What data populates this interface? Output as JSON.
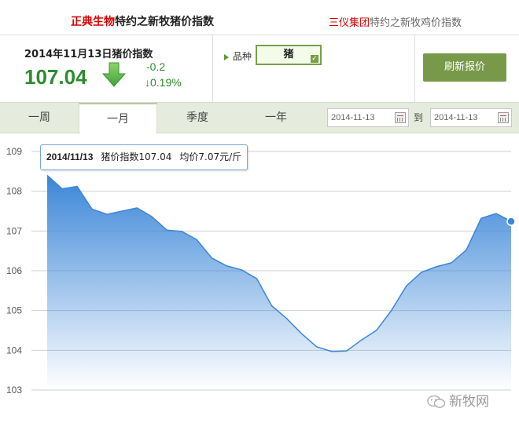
{
  "sponsors": {
    "left_brand": "正典生物",
    "left_text": "特约之新牧猪价指数",
    "right_brand": "三仪集团",
    "right_text": "特约之新牧鸡价指数"
  },
  "summary": {
    "title": "2014年11月13日猪价指数",
    "value": "107.04",
    "trend_icon": "arrow-down-icon",
    "change_abs": "-0.2",
    "change_pct": "↓0.19%"
  },
  "species": {
    "label": "品种",
    "selected": "猪"
  },
  "refresh_label": "刷新报价",
  "tabs": [
    {
      "label": "一周",
      "active": false
    },
    {
      "label": "一月",
      "active": true
    },
    {
      "label": "季度",
      "active": false
    },
    {
      "label": "一年",
      "active": false
    }
  ],
  "date_range": {
    "start": "2014-11-13",
    "separator": "到",
    "end": "2014-11-13"
  },
  "tooltip": {
    "date": "2014/11/13",
    "index_text": "猪价指数107.04",
    "avg_text": "均价7.07元/斤"
  },
  "watermark": "新牧网",
  "colors": {
    "accent_green": "#2e8b2e",
    "button_green": "#79994a",
    "brand_red": "#d60000",
    "series_blue": "#3b86d8"
  },
  "chart_data": {
    "type": "area",
    "yticks": [
      103,
      104,
      105,
      106,
      107,
      108,
      109
    ],
    "ylim": [
      103,
      109
    ],
    "values": [
      108.4,
      108.06,
      108.12,
      107.55,
      107.42,
      107.5,
      107.58,
      107.36,
      107.02,
      106.99,
      106.78,
      106.32,
      106.12,
      106.02,
      105.8,
      105.12,
      104.8,
      104.42,
      104.09,
      103.97,
      103.98,
      104.26,
      104.5,
      105.0,
      105.62,
      105.96,
      106.1,
      106.2,
      106.52,
      107.32,
      107.44,
      107.24
    ],
    "highlight_index": 31,
    "grid": true
  }
}
